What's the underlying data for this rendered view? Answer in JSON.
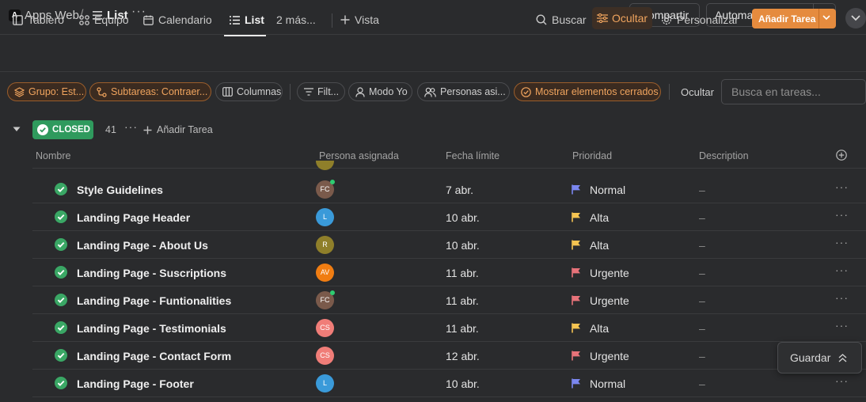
{
  "topbar": {
    "workspace_logo": "A",
    "workspace_name": "Apps Web",
    "separator": "/",
    "list_title": "List",
    "more": "···",
    "share_label": "Compartir",
    "automations_label": "Automatizaciones"
  },
  "views": {
    "tabs": [
      {
        "label": "Tablero",
        "icon": "board-icon"
      },
      {
        "label": "Equipo",
        "icon": "grid-icon"
      },
      {
        "label": "Calendario",
        "icon": "calendar-icon"
      },
      {
        "label": "List",
        "icon": "list-icon",
        "active": true
      },
      {
        "label": "2 más...",
        "icon": ""
      }
    ],
    "add_view": "Vista"
  },
  "tools": {
    "search": "Buscar",
    "hide": "Ocultar",
    "customize": "Personalizar",
    "add_task": "Añadir Tarea"
  },
  "filters": {
    "chips": [
      {
        "label": "Grupo: Est...",
        "style": "orange",
        "icon": "layers-icon"
      },
      {
        "label": "Subtareas: Contraer...",
        "style": "orange",
        "icon": "subtasks-icon"
      },
      {
        "label": "Columnas",
        "style": "default",
        "icon": "columns-icon"
      },
      {
        "label": "Filt...",
        "style": "default",
        "icon": "filter-icon"
      },
      {
        "label": "Modo Yo",
        "style": "default",
        "icon": "user-icon"
      },
      {
        "label": "Personas asi...",
        "style": "default",
        "icon": "users-icon"
      },
      {
        "label": "Mostrar elementos cerrados",
        "style": "orange",
        "icon": "check-circle-icon"
      }
    ],
    "hide_label": "Ocultar",
    "search_placeholder": "Busca en tareas..."
  },
  "group": {
    "status": "CLOSED",
    "count": "41",
    "more": "···",
    "add_task": "Añadir Tarea"
  },
  "columns": {
    "name": "Nombre",
    "assignee": "Persona asignada",
    "due": "Fecha límite",
    "priority": "Prioridad",
    "description": "Description"
  },
  "tasks": [
    {
      "name": "Style Guidelines",
      "initials": "FC",
      "avatar_color": "#7a5a4b",
      "online": true,
      "due": "7 abr.",
      "priority": "Normal",
      "flag_color": "#7b87f0",
      "description": "–"
    },
    {
      "name": "Landing Page Header",
      "initials": "L",
      "avatar_color": "#3a9ad9",
      "online": false,
      "due": "10 abr.",
      "priority": "Alta",
      "flag_color": "#f5c451",
      "description": "–"
    },
    {
      "name": "Landing Page - About Us",
      "initials": "R",
      "avatar_color": "#8f7f2a",
      "online": false,
      "due": "10 abr.",
      "priority": "Alta",
      "flag_color": "#f5c451",
      "description": "–"
    },
    {
      "name": "Landing Page - Suscriptions",
      "initials": "AV",
      "avatar_color": "#f07d12",
      "online": false,
      "due": "11 abr.",
      "priority": "Urgente",
      "flag_color": "#e8737a",
      "description": "–"
    },
    {
      "name": "Landing Page - Funtionalities",
      "initials": "FC",
      "avatar_color": "#7a5a4b",
      "online": true,
      "due": "11 abr.",
      "priority": "Urgente",
      "flag_color": "#e8737a",
      "description": "–"
    },
    {
      "name": "Landing Page - Testimonials",
      "initials": "CS",
      "avatar_color": "#f07d78",
      "online": false,
      "due": "11 abr.",
      "priority": "Alta",
      "flag_color": "#f5c451",
      "description": "–"
    },
    {
      "name": "Landing Page - Contact Form",
      "initials": "CS",
      "avatar_color": "#f07d78",
      "online": false,
      "due": "12 abr.",
      "priority": "Urgente",
      "flag_color": "#e8737a",
      "description": "–"
    },
    {
      "name": "Landing Page - Footer",
      "initials": "L",
      "avatar_color": "#3a9ad9",
      "online": false,
      "due": "10 abr.",
      "priority": "Normal",
      "flag_color": "#7b87f0",
      "description": "–"
    }
  ],
  "row_more": "···",
  "save_label": "Guardar",
  "colors": {
    "accent": "#e58b3e",
    "closed_green": "#2f9a5d",
    "check_green": "#3aa765"
  }
}
